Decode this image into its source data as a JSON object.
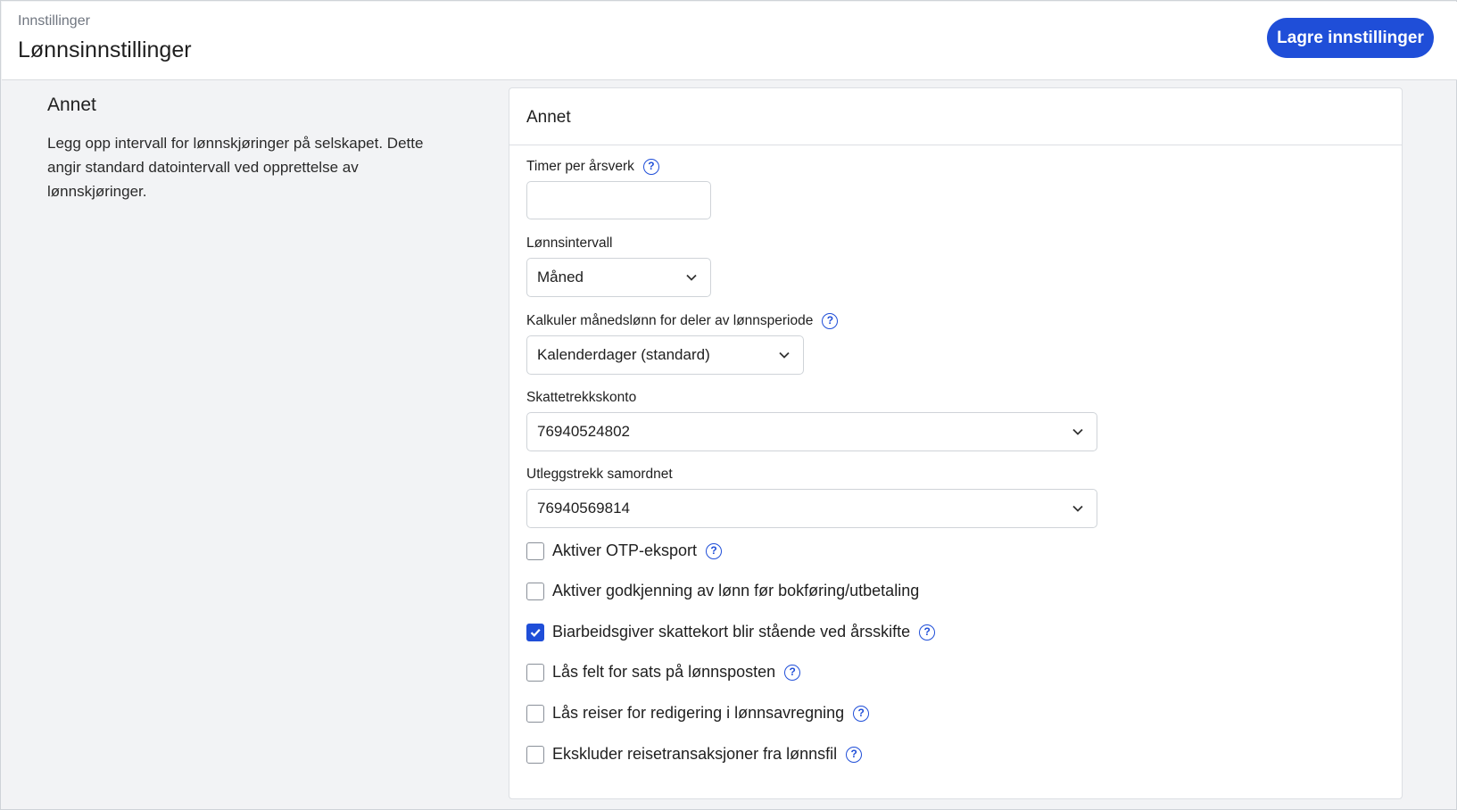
{
  "header": {
    "breadcrumb": "Innstillinger",
    "title": "Lønnsinnstillinger",
    "save_label": "Lagre innstillinger"
  },
  "section": {
    "title": "Annet",
    "description": "Legg opp intervall for lønnskjøringer på selskapet. Dette angir standard datointervall ved opprettelse av lønnskjøringer."
  },
  "card": {
    "title": "Annet",
    "fields": {
      "timer": {
        "label": "Timer per årsverk",
        "value": "",
        "help_icon": "question-circle-icon"
      },
      "intervall": {
        "label": "Lønnsintervall",
        "value": "Måned"
      },
      "kalkuler": {
        "label": "Kalkuler månedslønn for deler av lønnsperiode",
        "value": "Kalenderdager (standard)",
        "help_icon": "question-circle-icon"
      },
      "skattetrekk": {
        "label": "Skattetrekkskonto",
        "value": "76940524802"
      },
      "utlegg": {
        "label": "Utleggstrekk samordnet",
        "value": "76940569814"
      }
    },
    "checkboxes": [
      {
        "label": "Aktiver OTP-eksport",
        "checked": false,
        "has_help": true
      },
      {
        "label": "Aktiver godkjenning av lønn før bokføring/utbetaling",
        "checked": false,
        "has_help": false
      },
      {
        "label": "Biarbeidsgiver skattekort blir stående ved årsskifte",
        "checked": true,
        "has_help": true
      },
      {
        "label": "Lås felt for sats på lønnsposten",
        "checked": false,
        "has_help": true
      },
      {
        "label": "Lås reiser for redigering i lønnsavregning",
        "checked": false,
        "has_help": true
      },
      {
        "label": "Ekskluder reisetransaksjoner fra lønnsfil",
        "checked": false,
        "has_help": true
      }
    ]
  },
  "help_glyph": "?",
  "colors": {
    "accent": "#1f4ed8",
    "background": "#f2f3f5",
    "card": "#ffffff"
  }
}
